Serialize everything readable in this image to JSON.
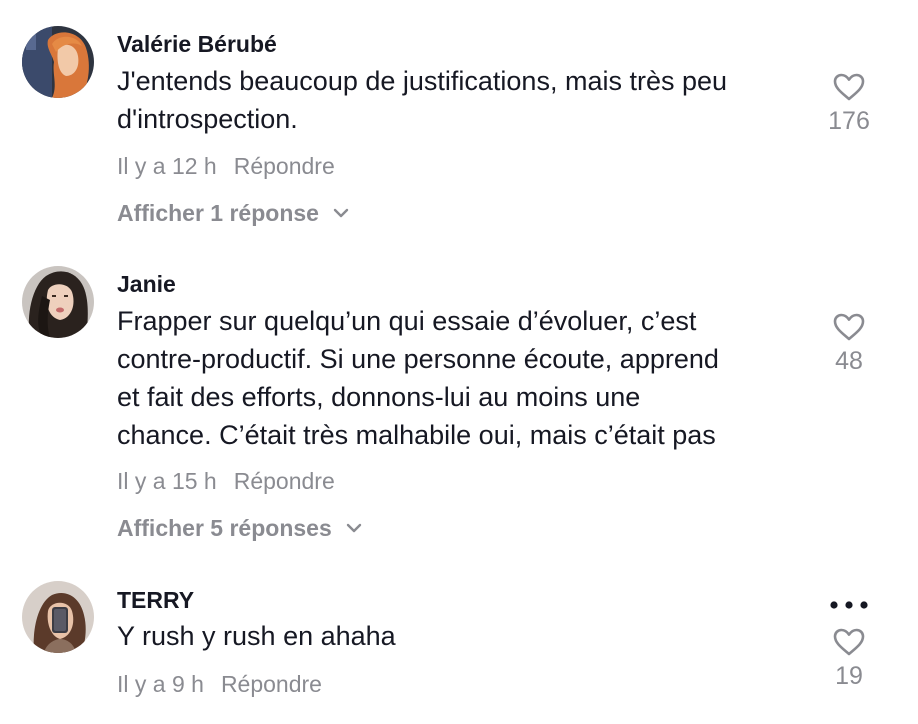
{
  "comments": [
    {
      "username": "Valérie Bérubé",
      "text_lines": [
        "J'entends beaucoup de justifications, mais très peu",
        "d'introspection."
      ],
      "time": "Il y a 12 h",
      "reply_label": "Répondre",
      "view_replies_label": "Afficher 1 réponse",
      "like_count": "176",
      "avatar": "avatar-red-hair"
    },
    {
      "username": "Janie",
      "text_lines": [
        "Frapper sur quelqu’un qui essaie d’évoluer, c’est",
        "contre-productif. Si une personne écoute, apprend",
        "et fait des efforts, donnons-lui au moins une",
        "chance. C’était très malhabile oui, mais c’était pas"
      ],
      "time": "Il y a 15 h",
      "reply_label": "Répondre",
      "view_replies_label": "Afficher 5 réponses",
      "like_count": "48",
      "avatar": "avatar-dark-hair"
    },
    {
      "username": "TERRY",
      "text_lines": [
        "Y rush y rush en ahaha"
      ],
      "time": "Il y a 9 h",
      "reply_label": "Répondre",
      "like_count": "19",
      "avatar": "avatar-mirror-selfie"
    }
  ],
  "icons": {
    "like": "heart-outline-icon",
    "expand": "chevron-down-icon",
    "more": "more-horizontal-icon"
  },
  "colors": {
    "primary_text": "#161823",
    "secondary_text": "#8a8b91",
    "background": "#ffffff"
  }
}
